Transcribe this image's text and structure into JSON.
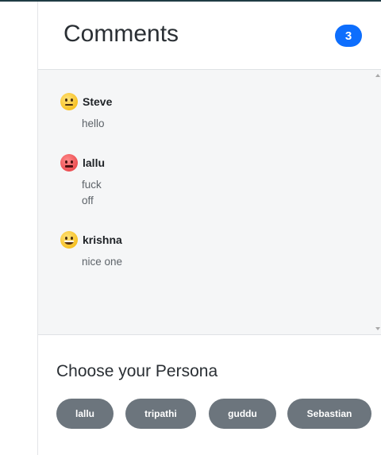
{
  "header": {
    "title": "Comments",
    "count": "3"
  },
  "comments": [
    {
      "user": "Steve",
      "emoji": "neutral-face-icon",
      "lines": [
        "hello"
      ]
    },
    {
      "user": "lallu",
      "emoji": "angry-face-icon",
      "lines": [
        "fuck",
        "off"
      ]
    },
    {
      "user": "krishna",
      "emoji": "grinning-face-icon",
      "lines": [
        "nice one"
      ]
    }
  ],
  "persona": {
    "title": "Choose your Persona",
    "options": [
      "lallu",
      "tripathi",
      "guddu",
      "Sebastian"
    ]
  },
  "colors": {
    "badge": "#0d6efd",
    "pill": "#6c757d",
    "list_background": "#f5f6f7"
  }
}
